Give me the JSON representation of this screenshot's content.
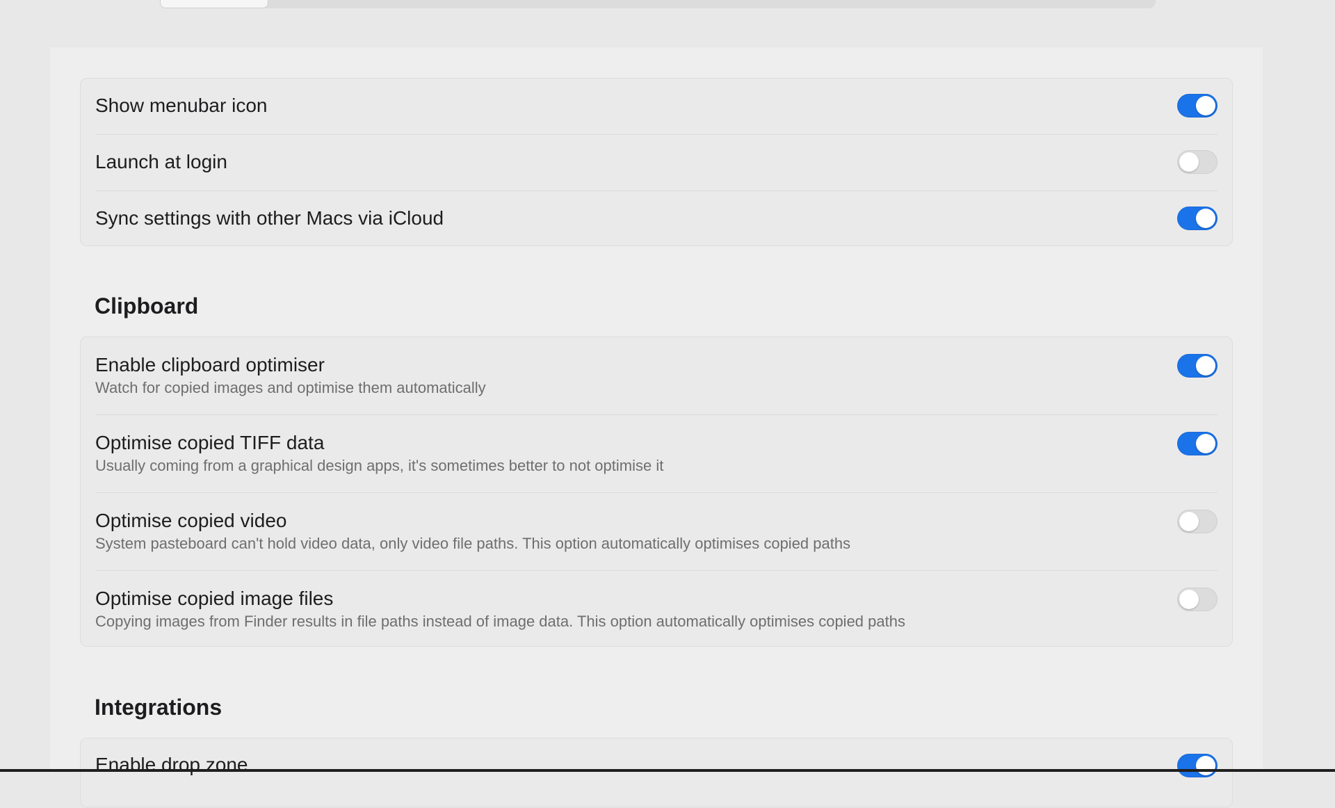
{
  "general": {
    "rows": [
      {
        "title": "Show menubar icon",
        "on": true
      },
      {
        "title": "Launch at login",
        "on": false
      },
      {
        "title": "Sync settings with other Macs via iCloud",
        "on": true
      }
    ]
  },
  "clipboard": {
    "heading": "Clipboard",
    "rows": [
      {
        "title": "Enable clipboard optimiser",
        "subtitle": "Watch for copied images and optimise them automatically",
        "on": true
      },
      {
        "title": "Optimise copied TIFF data",
        "subtitle": "Usually coming from a graphical design apps, it's sometimes better to not optimise it",
        "on": true
      },
      {
        "title": "Optimise copied video",
        "subtitle": "System pasteboard can't hold video data, only video file paths. This option automatically optimises copied paths",
        "on": false
      },
      {
        "title": "Optimise copied image files",
        "subtitle": "Copying images from Finder results in file paths instead of image data. This option automatically optimises copied paths",
        "on": false
      }
    ]
  },
  "integrations": {
    "heading": "Integrations",
    "rows": [
      {
        "title": "Enable drop zone",
        "on": true
      }
    ]
  },
  "colors": {
    "toggle_on": "#1a73e8",
    "toggle_off": "#dcdcdc"
  }
}
